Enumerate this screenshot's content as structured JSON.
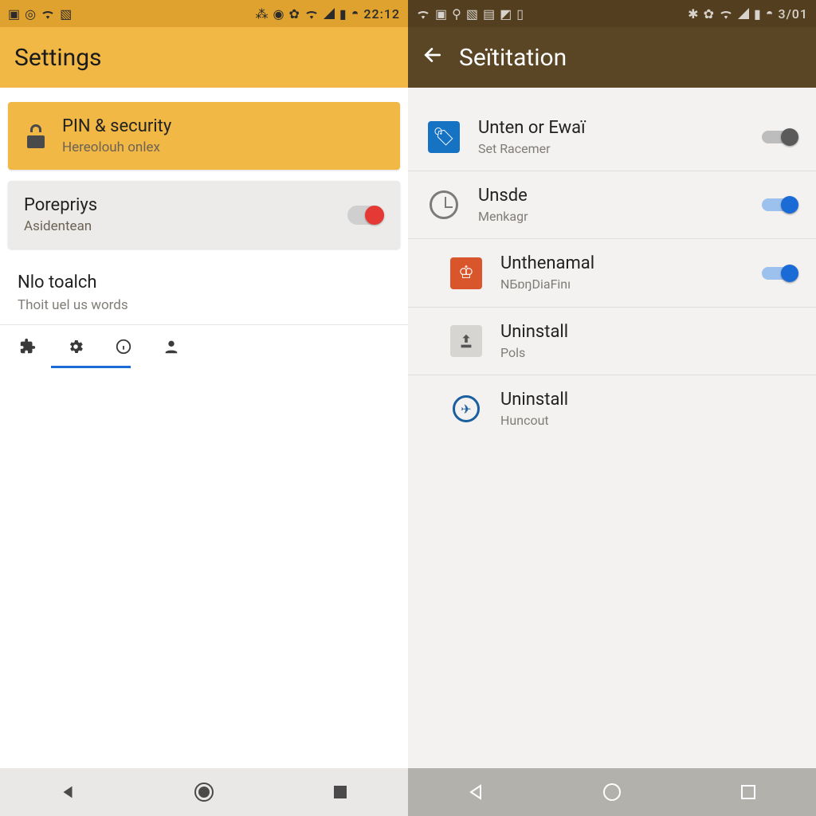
{
  "left": {
    "status": {
      "time": "22:12"
    },
    "appbar": {
      "title": "Settings"
    },
    "rows": {
      "pin": {
        "title": "PIN & security",
        "sub": "Hereolouh onlex"
      },
      "porepriys": {
        "title": "Porepriys",
        "sub": "Asidentean"
      },
      "toalch": {
        "title": "Nlo toalch",
        "sub": "Thoit uel us words"
      }
    }
  },
  "right": {
    "status": {
      "time": "3/01"
    },
    "appbar": {
      "title": "Seïtitation"
    },
    "rows": [
      {
        "title": "Unten or Ewaï",
        "sub": "Set Racemer",
        "toggle": "off"
      },
      {
        "title": "Unsde",
        "sub": "Menkagr",
        "toggle": "on"
      },
      {
        "title": "Unthenamal",
        "sub": "NБɒŋDiaFinı",
        "toggle": "on"
      },
      {
        "title": "Uninstall",
        "sub": "Pols"
      },
      {
        "title": "Uninstall",
        "sub": "Huncout"
      }
    ]
  }
}
